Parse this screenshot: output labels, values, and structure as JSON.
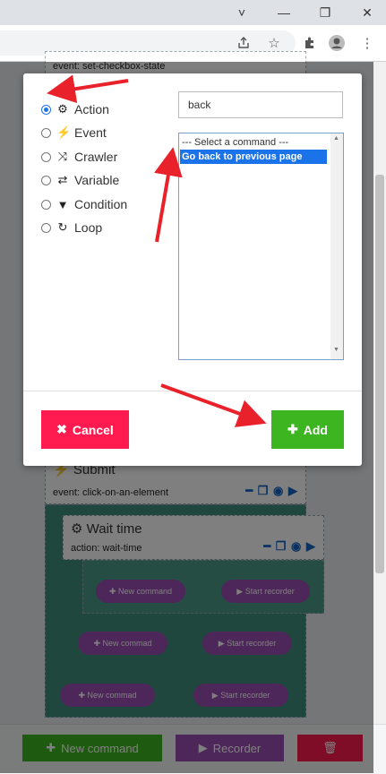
{
  "browser": {
    "controls": {
      "minimize_icon": "˅",
      "restore_icon": "—",
      "maximize_icon": "❐",
      "close_icon": "✕"
    },
    "toolbar_icons": [
      "share-icon",
      "star-icon",
      "extensions-icon",
      "profile-icon",
      "menu-icon"
    ]
  },
  "background": {
    "top_card": {
      "subtitle": "event: set-checkbox-state"
    },
    "submit_card": {
      "title": "Submit",
      "subtitle": "event: click-on-an-element"
    },
    "wait_card": {
      "title": "Wait time",
      "subtitle": "action: wait-time"
    },
    "pills": [
      {
        "new": "New command",
        "rec": "Start recorder"
      },
      {
        "new": "New commad",
        "rec": "Start recorder"
      },
      {
        "new": "New commad",
        "rec": "Start recorder"
      }
    ],
    "footer": {
      "new_command": "New command",
      "recorder": "Recorder"
    }
  },
  "modal": {
    "types": [
      {
        "label": "Action",
        "icon": "gear-icon",
        "checked": true
      },
      {
        "label": "Event",
        "icon": "bolt-icon",
        "checked": false
      },
      {
        "label": "Crawler",
        "icon": "shuffle-icon",
        "checked": false
      },
      {
        "label": "Variable",
        "icon": "arrows-icon",
        "checked": false
      },
      {
        "label": "Condition",
        "icon": "filter-icon",
        "checked": false
      },
      {
        "label": "Loop",
        "icon": "redo-icon",
        "checked": false
      }
    ],
    "search_value": "back",
    "options": [
      "--- Select a command ---",
      "Go back to previous page"
    ],
    "selected_option": "Go back to previous page",
    "cancel_label": "Cancel",
    "add_label": "Add"
  },
  "colors": {
    "add": "#3cb521",
    "cancel": "#ff1a4f",
    "recorder": "#9b4fb4",
    "annotation_arrow": "#e8212a"
  }
}
